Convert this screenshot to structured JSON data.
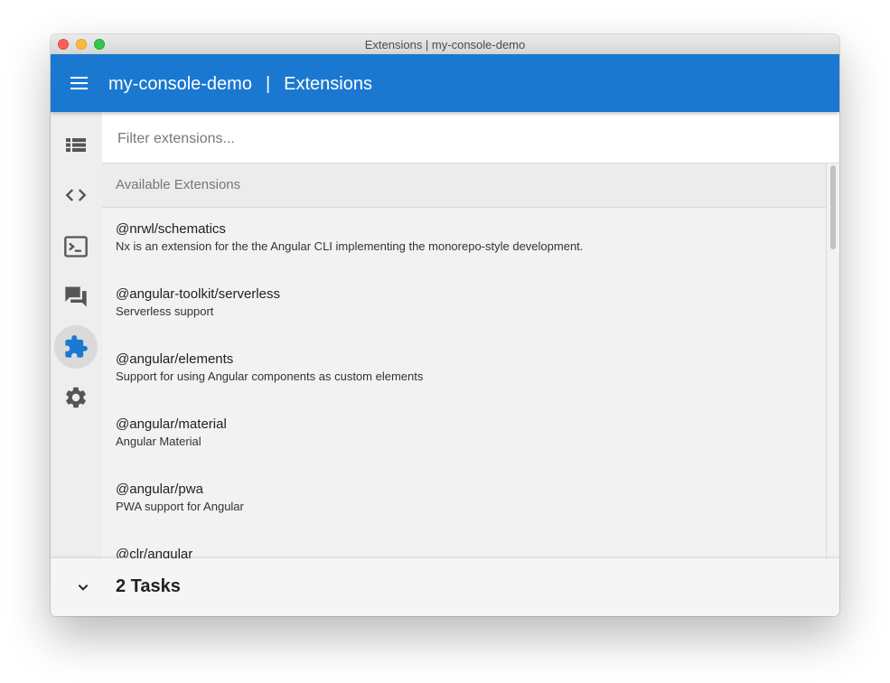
{
  "window": {
    "title": "Extensions | my-console-demo"
  },
  "appbar": {
    "workspace": "my-console-demo",
    "separator": "|",
    "page": "Extensions"
  },
  "sidebar": {
    "items": [
      {
        "name": "projects",
        "icon": "list-icon",
        "active": false
      },
      {
        "name": "generate",
        "icon": "code-icon",
        "active": false
      },
      {
        "name": "tasks",
        "icon": "terminal-icon",
        "active": false
      },
      {
        "name": "support",
        "icon": "forum-icon",
        "active": false
      },
      {
        "name": "extensions",
        "icon": "extension-puzzle-icon",
        "active": true
      },
      {
        "name": "settings",
        "icon": "gear-icon",
        "active": false
      }
    ]
  },
  "filter": {
    "placeholder": "Filter extensions...",
    "value": "",
    "icon": "filter-list-icon"
  },
  "section": {
    "title": "Available Extensions"
  },
  "extensions": [
    {
      "name": "@nrwl/schematics",
      "description": "Nx is an extension for the the Angular CLI implementing the monorepo-style development."
    },
    {
      "name": "@angular-toolkit/serverless",
      "description": "Serverless support"
    },
    {
      "name": "@angular/elements",
      "description": "Support for using Angular components as custom elements"
    },
    {
      "name": "@angular/material",
      "description": "Angular Material"
    },
    {
      "name": "@angular/pwa",
      "description": "PWA support for Angular"
    },
    {
      "name": "@clr/angular",
      "description": ""
    }
  ],
  "tasks": {
    "label": "2 Tasks",
    "toggle_icon": "chevron-down-icon"
  },
  "colors": {
    "accent": "#1b78d0",
    "active_icon": "#1b78d0",
    "inactive_icon": "#555555"
  }
}
